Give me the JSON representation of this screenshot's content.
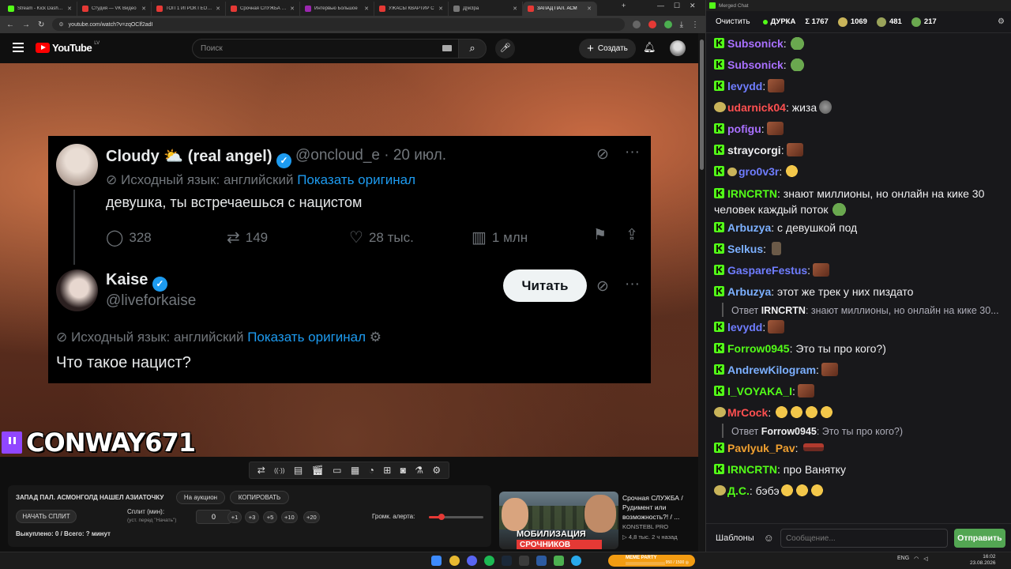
{
  "browser": {
    "tabs": [
      {
        "title": "Stream - Kick Dashboa",
        "color": "#53fc18"
      },
      {
        "title": "Студия — VK Видео",
        "color": "#e53935"
      },
      {
        "title": "ТОП 1 ИГРОК ГЕОГЕС",
        "color": "#e53935"
      },
      {
        "title": "Срочная СЛУЖБА / Р",
        "color": "#e53935"
      },
      {
        "title": "Интервью Большое",
        "color": "#9c27b0"
      },
      {
        "title": "УЖАСЫ КВАРТИР С",
        "color": "#e53935"
      },
      {
        "title": "Д[мЗра",
        "color": "#777777"
      },
      {
        "title": "ЗАПАД ПАЛ. АСМ",
        "color": "#e53935",
        "active": true
      }
    ],
    "url": "youtube.com/watch?v=zqOClf2adI"
  },
  "youtube": {
    "logo_text": "YouTube",
    "country_code": "LV",
    "search_placeholder": "Поиск",
    "create_label": "Создать"
  },
  "tweet": {
    "first": {
      "name": "Cloudy ⛅ (real angel)",
      "handle_date": "@oncloud_e · 20 июл.",
      "translated_label": "Исходный язык: английский",
      "show_original": "Показать оригинал",
      "text": "девушка, ты встречаешься с нацистом",
      "replies": "328",
      "reposts": "149",
      "likes": "28 тыс.",
      "views": "1 млн"
    },
    "second": {
      "name": "Kaise",
      "handle": "@liveforkaise",
      "follow_label": "Читать",
      "translated_label": "Исходный язык: английский",
      "show_original": "Показать оригинал",
      "text": "Что такое нацист?"
    }
  },
  "stream_overlay": {
    "streamer_name": "CONWAY671"
  },
  "player_controls": [
    "loop-icon",
    "broadcast-icon",
    "subtitles-icon",
    "clapper-icon",
    "window-icon",
    "film-icon",
    "speed-icon",
    "add-icon",
    "screenshot-icon",
    "flask-icon",
    "settings-icon"
  ],
  "panel": {
    "video_title": "ЗАПАД ПАЛ. АСМОНГОЛД НАШЕЛ АЗИАТОЧКУ",
    "auction_btn": "На аукцион",
    "copy_btn": "КОПИРОВАТЬ",
    "start_split_btn": "НАЧАТЬ СПЛИТ",
    "split_label": "Сплит (мин):",
    "split_hint": "(уст. перед \"Начать\")",
    "split_value": "0",
    "increments": [
      "+1",
      "+3",
      "+5",
      "+10",
      "+20"
    ],
    "volume_label": "Громк. алерта:",
    "volume_level": 0.23,
    "bought_text": "Выкуплено: 0 / Всего: ? минут"
  },
  "recommendation": {
    "title": "Срочная СЛУЖБА / Рудимент или возможность?! / ...",
    "channel": "KONSTEBL PRO",
    "meta": "▷ 4,8 тыс.   2 ч назад",
    "thumb_text_1": "МОБИЛИЗАЦИЯ",
    "thumb_text_2": "СРОЧНИКОВ"
  },
  "taskbar": {
    "widget_label": "MEME PARTY",
    "widget_count": "950 / 1500 ◎",
    "lang": "ENG",
    "time": "16:02",
    "date": "23.08.2026"
  },
  "chat": {
    "window_title": "Merged Chat",
    "clear_label": "Очистить",
    "channel": "ДУРКА",
    "stat_total": "Σ 1767",
    "stat_a": "1069",
    "stat_b": "481",
    "stat_c": "217",
    "templates_label": "Шаблоны",
    "input_placeholder": "Сообщение...",
    "send_label": "Отправить",
    "messages": [
      {
        "user": "Subsonick",
        "color": "#a970ff",
        "text": "",
        "emote": "e-pepe",
        "badge": "kick"
      },
      {
        "user": "Subsonick",
        "color": "#a970ff",
        "text": "",
        "emote": "e-pepe",
        "badge": "kick"
      },
      {
        "user": "levydd",
        "color": "#6f7dff",
        "text": "",
        "emote": "e-face",
        "badge": "kick"
      },
      {
        "user": "udarnick04",
        "color": "#ff5050",
        "text": " жиза",
        "emote": "e-round",
        "badge": "twitch"
      },
      {
        "user": "pofigu",
        "color": "#a970ff",
        "text": "",
        "emote": "e-face",
        "badge": "kick"
      },
      {
        "user": "straycorgi",
        "color": "#efeff1",
        "text": "",
        "emote": "e-face",
        "badge": "kick"
      },
      {
        "user": "gro0v3r",
        "color": "#6f7dff",
        "text": "",
        "emote": "e-cry",
        "badge": "kick2"
      },
      {
        "user": "IRNCRTN",
        "color": "#53fc18",
        "text": " знают миллионы, но онлайн на кике 30 человек каждый поток",
        "emote": "e-pepe",
        "badge": "kick",
        "wrap": true
      },
      {
        "user": "Arbuzya",
        "color": "#7cb0ff",
        "text": " с девушкой под",
        "emote": "",
        "badge": "kick"
      },
      {
        "user": "Selkus",
        "color": "#7cb0ff",
        "text": " ",
        "emote": "e-smol",
        "badge": "kick"
      },
      {
        "user": "GaspareFestus",
        "color": "#6f7dff",
        "text": "",
        "emote": "e-face",
        "badge": "kick"
      },
      {
        "user": "Arbuzya",
        "color": "#7cb0ff",
        "text": " этот же трек у них пиздато",
        "emote": "",
        "badge": "kick"
      },
      {
        "user": "levydd",
        "color": "#6f7dff",
        "text": "",
        "emote": "e-face",
        "badge": "kick",
        "reply_user": "IRNCRTN",
        "reply_text": ": знают миллионы, но онлайн на кике 30..."
      },
      {
        "user": "Forrow0945",
        "color": "#53fc18",
        "text": " Это ты про кого?)",
        "emote": "",
        "badge": "kick"
      },
      {
        "user": "AndrewKilogram",
        "color": "#7cb0ff",
        "text": "",
        "emote": "e-face",
        "badge": "kick"
      },
      {
        "user": "I_VOYAKA_I",
        "color": "#53fc18",
        "text": "",
        "emote": "e-face",
        "badge": "kick"
      },
      {
        "user": "MrCock",
        "color": "#ff5050",
        "text": " ",
        "emote": "e-cry4",
        "badge": "twitch"
      },
      {
        "user": "Pavlyuk_Pav",
        "color": "#f0a030",
        "text": " ",
        "emote": "e-flag",
        "badge": "kick",
        "reply_user": "Forrow0945",
        "reply_text": ": Это ты про кого?)"
      },
      {
        "user": "IRNCRTN",
        "color": "#53fc18",
        "text": " про Ванятку",
        "emote": "",
        "badge": "kick"
      },
      {
        "user": "Д.С.",
        "color": "#53fc18",
        "text": " бэбэ",
        "emote": "e-cry3",
        "badge": "twitch"
      }
    ]
  }
}
